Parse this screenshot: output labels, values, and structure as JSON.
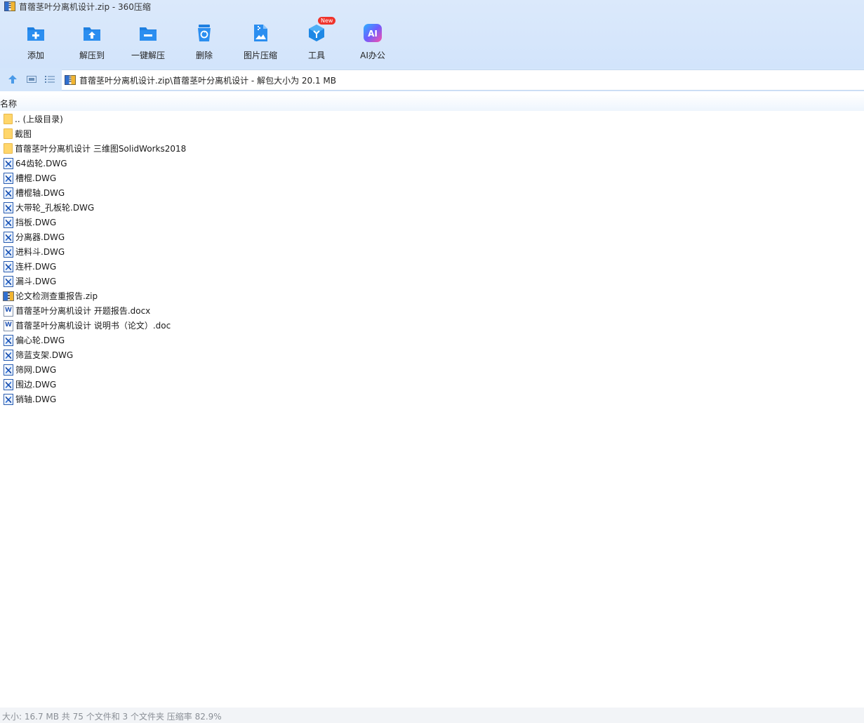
{
  "window": {
    "title": "苜蓿茎叶分离机设计.zip - 360压缩"
  },
  "toolbar": {
    "buttons": [
      {
        "label": "添加",
        "icon": "add-folder-icon"
      },
      {
        "label": "解压到",
        "icon": "extract-to-icon"
      },
      {
        "label": "一键解压",
        "icon": "one-click-extract-icon"
      },
      {
        "label": "删除",
        "icon": "delete-trash-icon"
      },
      {
        "label": "图片压缩",
        "icon": "image-compress-icon"
      },
      {
        "label": "工具",
        "icon": "tools-cube-icon",
        "badge": "New"
      },
      {
        "label": "AI办公",
        "icon": "ai-office-icon"
      }
    ]
  },
  "nav": {
    "address": "苜蓿茎叶分离机设计.zip\\苜蓿茎叶分离机设计 - 解包大小为 20.1 MB"
  },
  "columns": {
    "name": "名称"
  },
  "files": [
    {
      "name": ".. (上级目录)",
      "type": "folder"
    },
    {
      "name": "截图",
      "type": "folder"
    },
    {
      "name": "苜蓿茎叶分离机设计 三维图SolidWorks2018",
      "type": "folder"
    },
    {
      "name": "64齿轮.DWG",
      "type": "dwg"
    },
    {
      "name": "槽棍.DWG",
      "type": "dwg"
    },
    {
      "name": "槽棍轴.DWG",
      "type": "dwg"
    },
    {
      "name": "大带轮_孔板轮.DWG",
      "type": "dwg"
    },
    {
      "name": "挡板.DWG",
      "type": "dwg"
    },
    {
      "name": "分离器.DWG",
      "type": "dwg"
    },
    {
      "name": "进料斗.DWG",
      "type": "dwg"
    },
    {
      "name": "连杆.DWG",
      "type": "dwg"
    },
    {
      "name": "漏斗.DWG",
      "type": "dwg"
    },
    {
      "name": "论文检测查重报告.zip",
      "type": "zip"
    },
    {
      "name": "苜蓿茎叶分离机设计 开题报告.docx",
      "type": "word"
    },
    {
      "name": "苜蓿茎叶分离机设计 说明书（论文）.doc",
      "type": "word"
    },
    {
      "name": "偏心轮.DWG",
      "type": "dwg"
    },
    {
      "name": "筛蓝支架.DWG",
      "type": "dwg"
    },
    {
      "name": "筛网.DWG",
      "type": "dwg"
    },
    {
      "name": "围边.DWG",
      "type": "dwg"
    },
    {
      "name": "销轴.DWG",
      "type": "dwg"
    }
  ],
  "status": {
    "text": "大小: 16.7 MB 共 75 个文件和 3 个文件夹 压缩率 82.9%"
  },
  "colors": {
    "chrome_bg": "#d6e6fb",
    "accent_blue": "#1e88e5",
    "badge_red": "#f0332b"
  }
}
